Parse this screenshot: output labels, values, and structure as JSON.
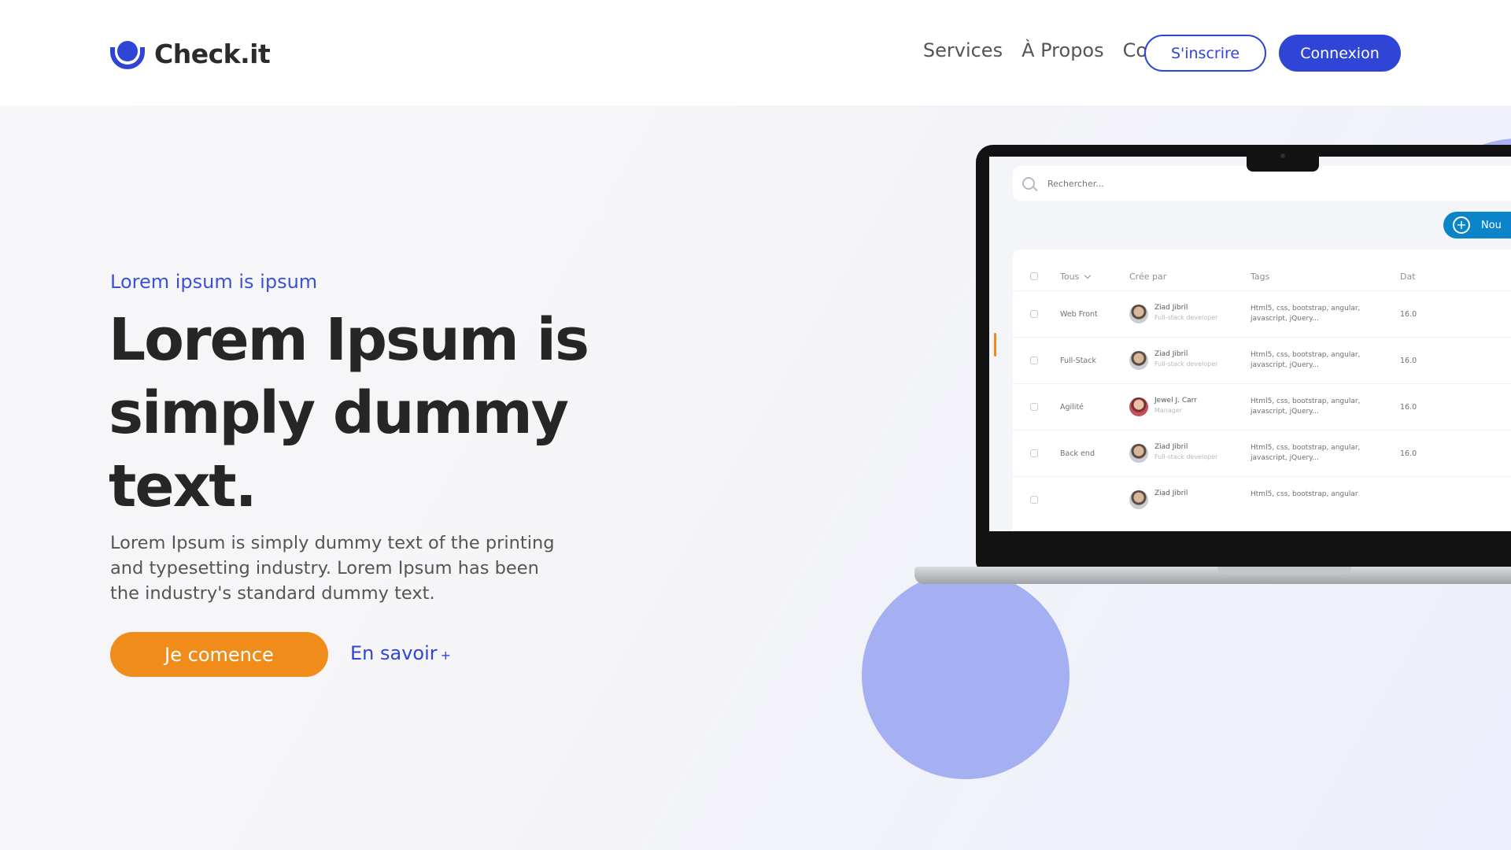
{
  "header": {
    "brand": "Check.it",
    "nav": [
      "Services",
      "À Propos",
      "Contact"
    ],
    "signup_label": "S'inscrire",
    "login_label": "Connexion"
  },
  "hero": {
    "eyebrow": "Lorem ipsum is ipsum",
    "title": "Lorem Ipsum is simply dummy text.",
    "description": "Lorem Ipsum is simply dummy text of the printing and typesetting industry. Lorem Ipsum has been the industry's standard dummy text.",
    "cta_primary": "Je comence",
    "cta_secondary": "En savoir",
    "cta_secondary_suffix": "+"
  },
  "mockup": {
    "search_placeholder": "Rechercher...",
    "new_button": "Nou",
    "columns": [
      "Tous",
      "Crée par",
      "Tags",
      "Dat"
    ],
    "rows": [
      {
        "category": "Web Front",
        "name": "Ziad Jibril",
        "role": "Full-stack developer",
        "tags": "Html5, css, bootstrap,  angular, javascript, jQuery...",
        "date": "16.0",
        "avatar": "default"
      },
      {
        "category": "Full-Stack",
        "name": "Ziad Jibril",
        "role": "Full-stack developer",
        "tags": "Html5, css, bootstrap,  angular, javascript, jQuery...",
        "date": "16.0",
        "avatar": "default"
      },
      {
        "category": "Agilité",
        "name": "Jewel J. Carr",
        "role": "Manager",
        "tags": "Html5, css, bootstrap,  angular, javascript, jQuery...",
        "date": "16.0",
        "avatar": "red"
      },
      {
        "category": "Back end",
        "name": "Ziad Jibril",
        "role": "Full-stack developer",
        "tags": "Html5, css, bootstrap,  angular, javascript, jQuery...",
        "date": "16.0",
        "avatar": "default"
      },
      {
        "category": "",
        "name": "Ziad Jibril",
        "role": "",
        "tags": "Html5, css, bootstrap,  angular",
        "date": "",
        "avatar": "default"
      }
    ]
  },
  "colors": {
    "brand_blue": "#2e45d6",
    "accent_orange": "#f08c1a",
    "decor_purple": "#a7b1f3",
    "mockup_button_blue": "#0b84c9"
  },
  "icons": {
    "logo": "bowl-dot-logo-icon",
    "search": "search-icon",
    "new": "plus-circle-icon",
    "dropdown": "chevron-down-icon"
  }
}
